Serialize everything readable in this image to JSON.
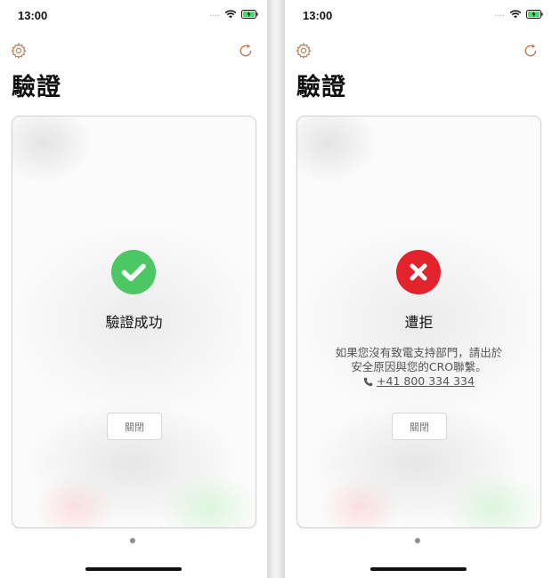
{
  "colors": {
    "accent": "#b5835a",
    "success": "#4cc764",
    "error": "#e3232b"
  },
  "screens": [
    {
      "status_bar": {
        "time": "13:00",
        "signal_dots": "....",
        "icons": [
          "wifi-icon",
          "battery-charging-icon"
        ]
      },
      "toolbar": {
        "left_icon": "gear-icon",
        "right_icon": "refresh-icon"
      },
      "title": "驗證",
      "card": {
        "status_icon": "checkmark-icon",
        "result": "驗證成功",
        "close_button": "關閉"
      }
    },
    {
      "status_bar": {
        "time": "13:00",
        "signal_dots": "....",
        "icons": [
          "wifi-icon",
          "battery-charging-icon"
        ]
      },
      "toolbar": {
        "left_icon": "gear-icon",
        "right_icon": "refresh-icon"
      },
      "title": "驗證",
      "card": {
        "status_icon": "cross-icon",
        "result": "遭拒",
        "message_line1": "如果您沒有致電支持部門，請出於",
        "message_line2": "安全原因與您的CRO聯繫。",
        "phone_icon": "phone-icon",
        "phone_number": "+41 800 334 334",
        "close_button": "關閉"
      }
    }
  ]
}
